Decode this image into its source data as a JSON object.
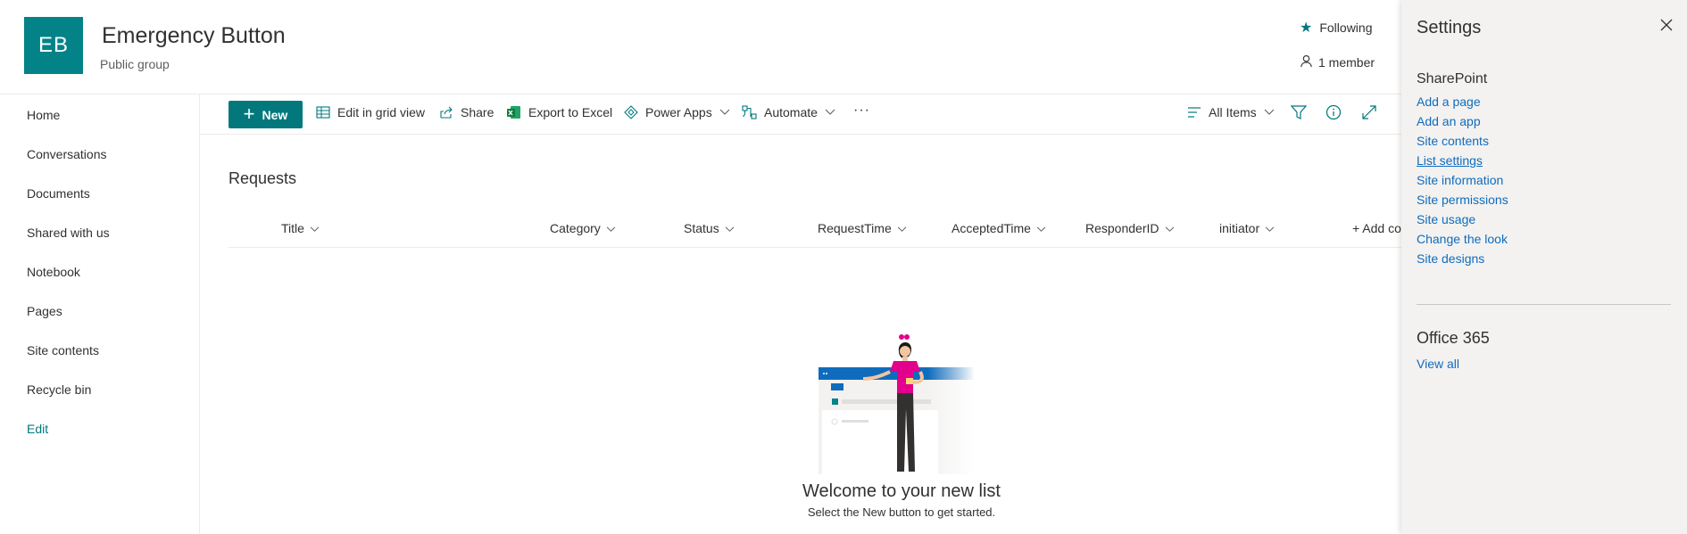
{
  "header": {
    "logo_initials": "EB",
    "site_title": "Emergency Button",
    "site_subtitle": "Public group",
    "following_label": "Following",
    "members_label": "1 member"
  },
  "left_nav": {
    "items": [
      {
        "label": "Home"
      },
      {
        "label": "Conversations"
      },
      {
        "label": "Documents"
      },
      {
        "label": "Shared with us"
      },
      {
        "label": "Notebook"
      },
      {
        "label": "Pages"
      },
      {
        "label": "Site contents"
      },
      {
        "label": "Recycle bin"
      }
    ],
    "edit_label": "Edit"
  },
  "command_bar": {
    "new_label": "New",
    "edit_grid_label": "Edit in grid view",
    "share_label": "Share",
    "export_label": "Export to Excel",
    "power_apps_label": "Power Apps",
    "automate_label": "Automate",
    "more_label": "···",
    "view_label": "All Items"
  },
  "list": {
    "title": "Requests",
    "columns": [
      "Title",
      "Category",
      "Status",
      "RequestTime",
      "AcceptedTime",
      "ResponderID",
      "initiator"
    ],
    "add_column_label": "+ Add co",
    "empty_title": "Welcome to your new list",
    "empty_subtitle": "Select the New button to get started."
  },
  "settings": {
    "title": "Settings",
    "sharepoint_heading": "SharePoint",
    "sharepoint_links": [
      {
        "label": "Add a page"
      },
      {
        "label": "Add an app"
      },
      {
        "label": "Site contents"
      },
      {
        "label": "List settings"
      },
      {
        "label": "Site information"
      },
      {
        "label": "Site permissions"
      },
      {
        "label": "Site usage"
      },
      {
        "label": "Change the look"
      },
      {
        "label": "Site designs"
      }
    ],
    "office_heading": "Office 365",
    "view_all_label": "View all"
  },
  "colors": {
    "brand_teal": "#038387",
    "button_teal": "#03787c",
    "link_blue": "#0f6cbd",
    "panel_bg": "#f3f2f1"
  },
  "icons": {
    "following": "star-icon",
    "members": "person-icon",
    "close": "close-icon"
  }
}
